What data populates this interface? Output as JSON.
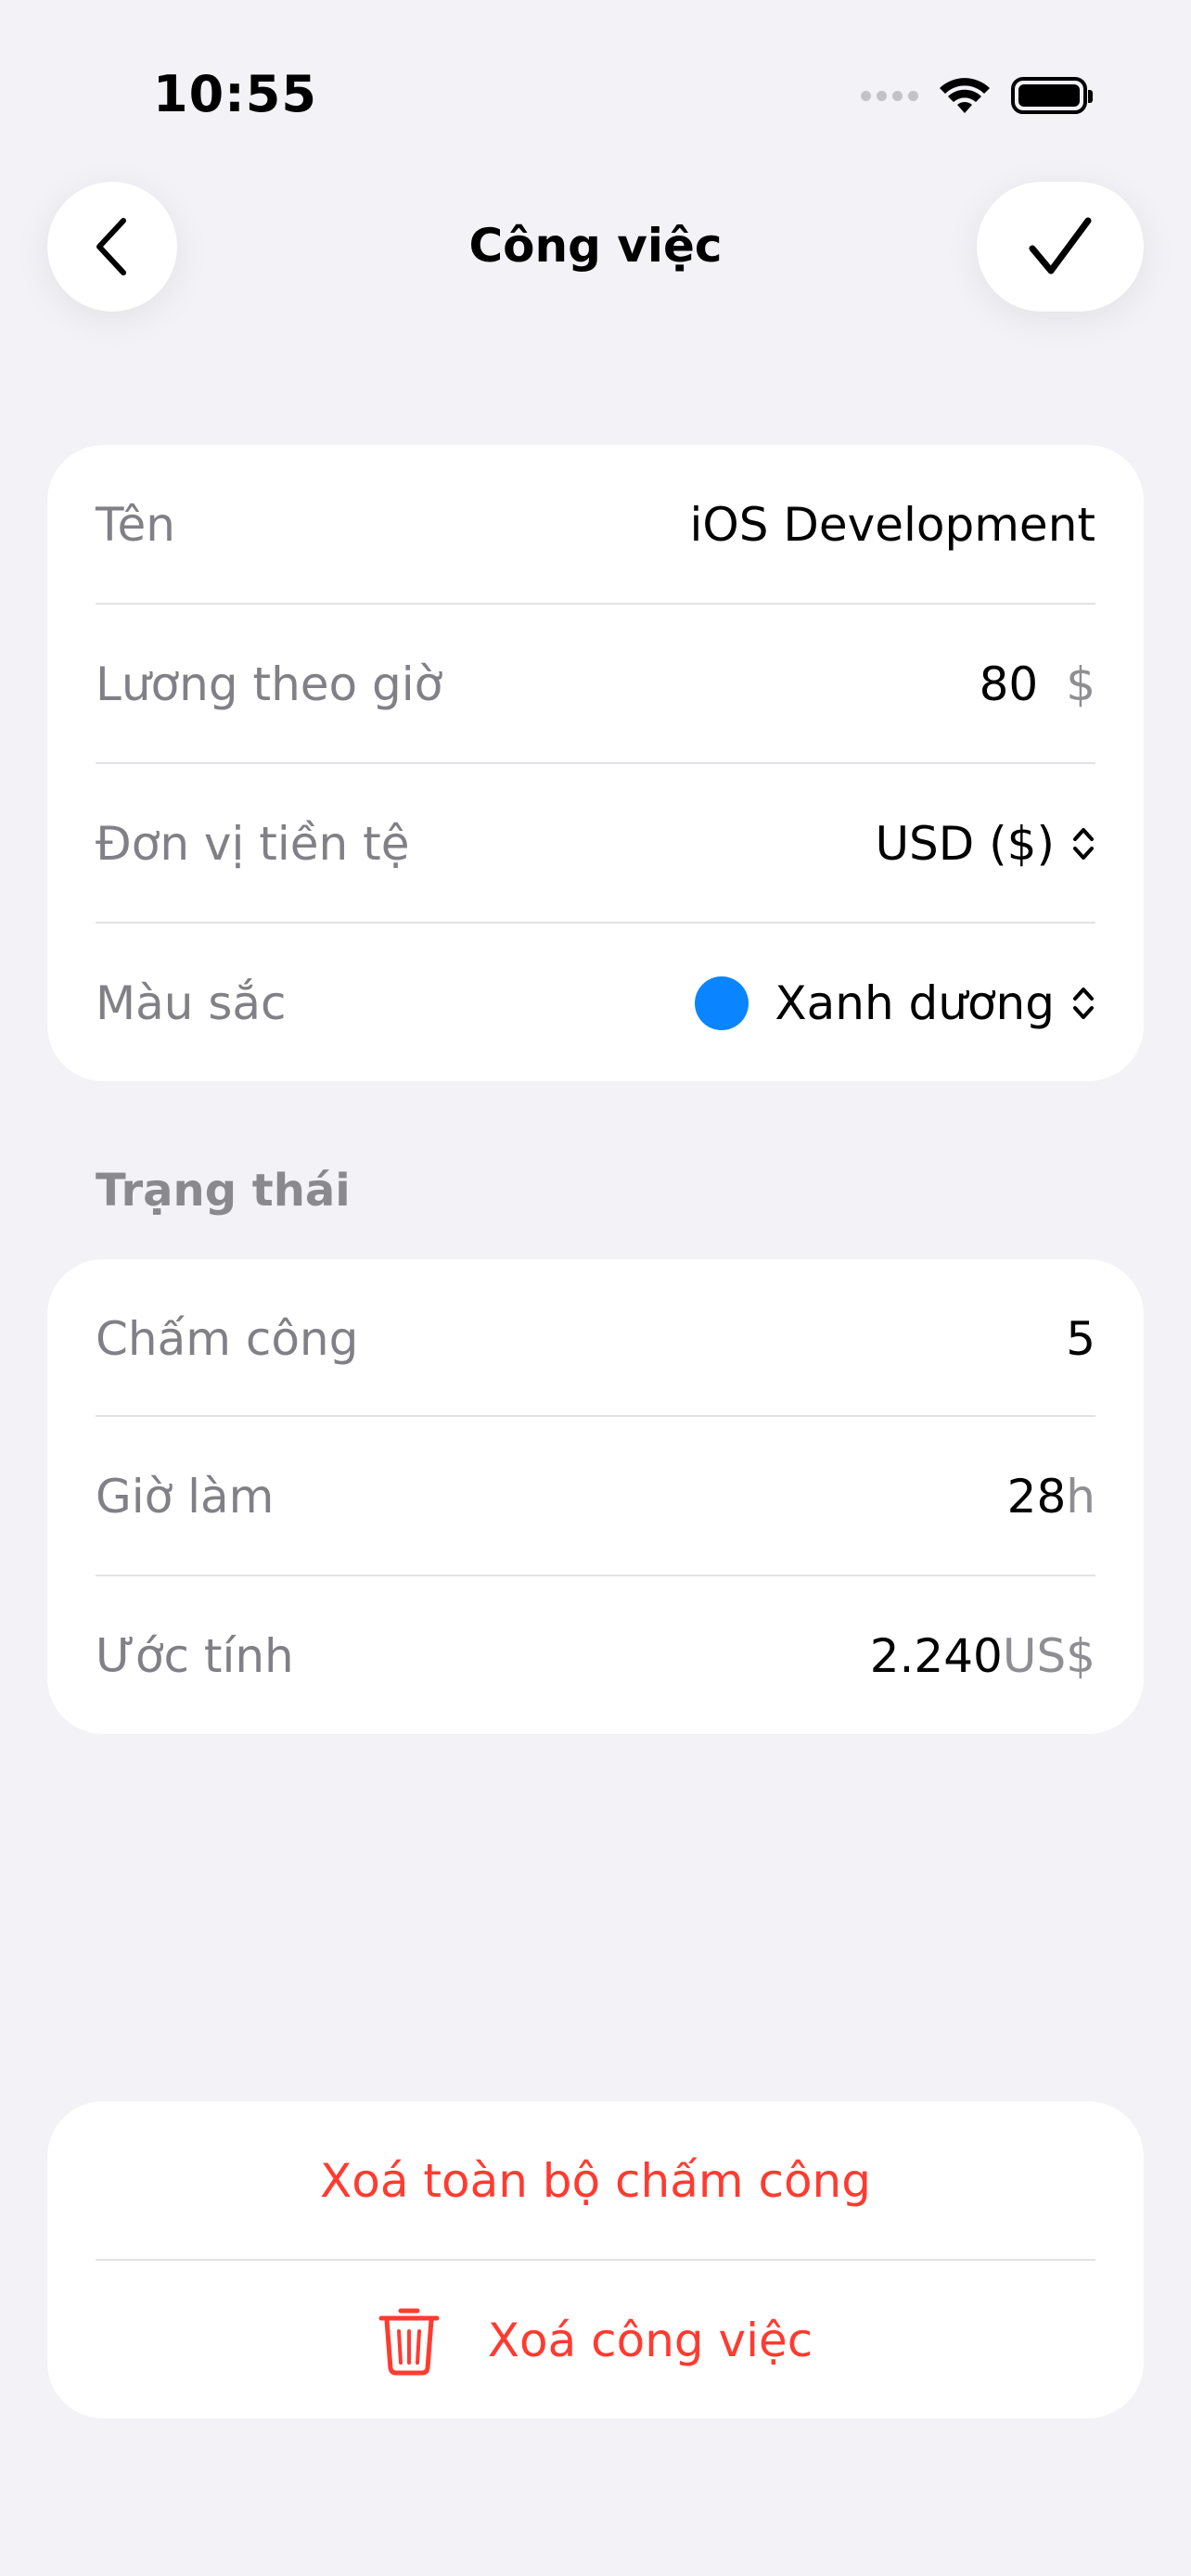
{
  "status_bar": {
    "time": "10:55"
  },
  "nav": {
    "title": "Công việc",
    "back_icon": "chevron-left-icon",
    "done_icon": "checkmark-icon"
  },
  "job_form": {
    "name_label": "Tên",
    "name_value": "iOS Development",
    "rate_label": "Lương theo giờ",
    "rate_value": "80",
    "rate_unit": "$",
    "currency_label": "Đơn vị tiền tệ",
    "currency_value": "USD ($)",
    "color_label": "Màu sắc",
    "color_value": "Xanh dương",
    "color_hex": "#0A84FF"
  },
  "status_section": {
    "header": "Trạng thái",
    "checkins_label": "Chấm công",
    "checkins_value": "5",
    "hours_label": "Giờ làm",
    "hours_value": "28",
    "hours_unit": "h",
    "estimate_label": "Ước tính",
    "estimate_value": "2.240",
    "estimate_unit": "US$"
  },
  "actions": {
    "delete_checkins": "Xoá toàn bộ chấm công",
    "delete_job": "Xoá công việc",
    "destructive_color": "#FF3B30"
  }
}
